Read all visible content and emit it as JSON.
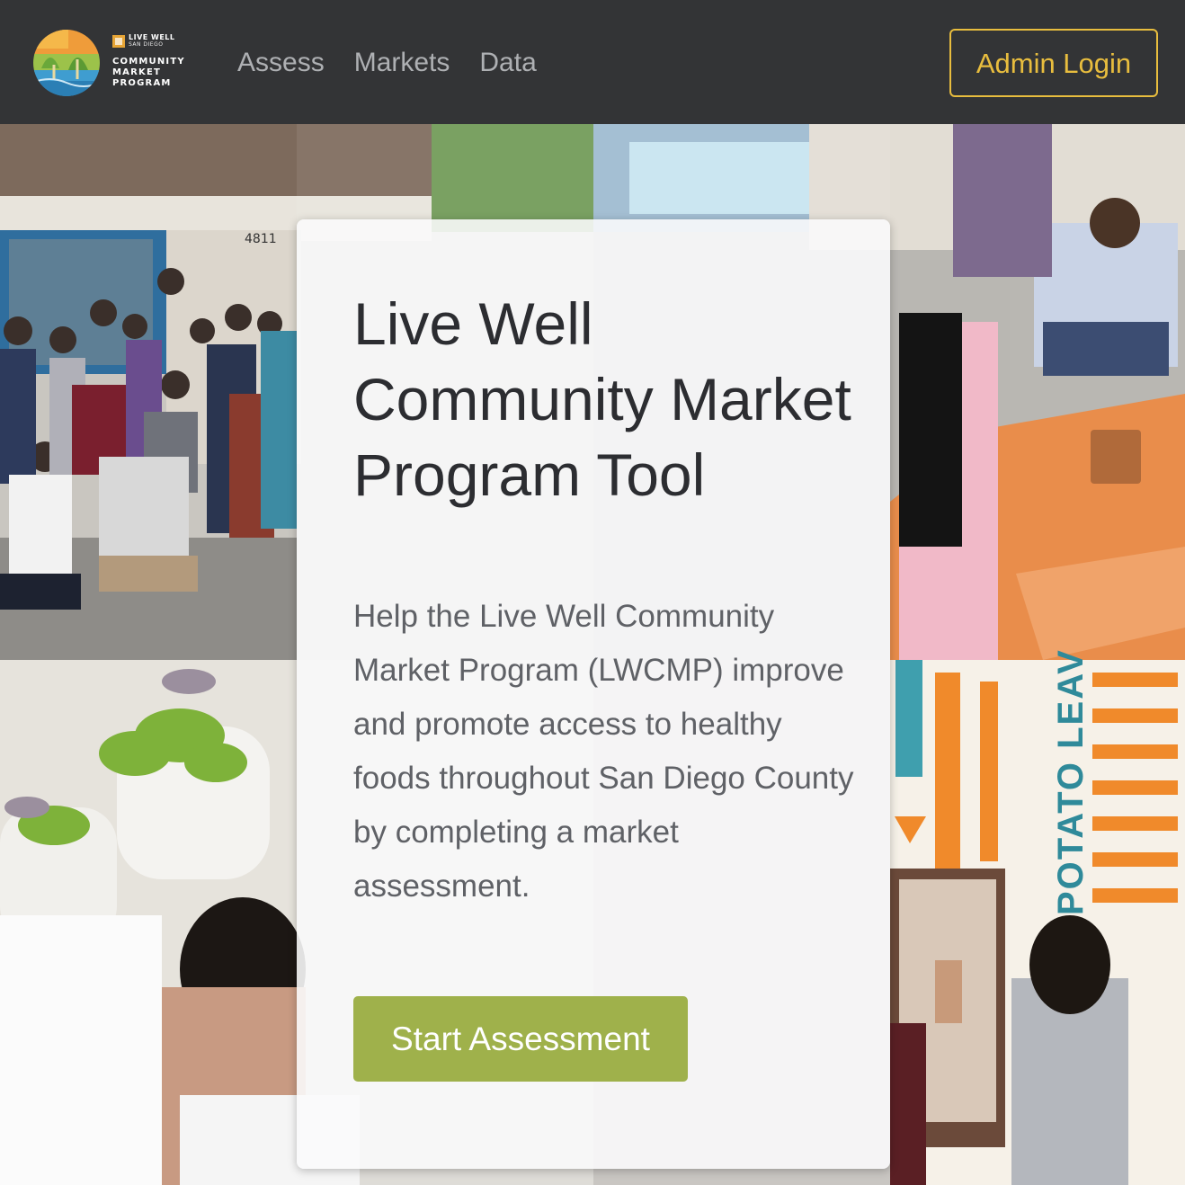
{
  "brand": {
    "line1": "LIVE WELL",
    "line2": "SAN DIEGO",
    "line3": "COMMUNITY",
    "line4": "MARKET",
    "line5": "PROGRAM"
  },
  "nav": {
    "links": [
      "Assess",
      "Markets",
      "Data"
    ],
    "admin_label": "Admin Login"
  },
  "hero": {
    "title": "Live Well Community Market Program Tool",
    "description": "Help the Live Well Community Market Program (LWCMP) improve and promote access to healthy foods throughout San Diego County by completing a market assessment.",
    "cta_label": "Start Assessment",
    "photo_texts": {
      "address": "4811",
      "mural": "POTATO LEAV"
    }
  },
  "colors": {
    "navbar": "#333436",
    "nav_link": "#aeb0b3",
    "accent_yellow": "#e8bd3e",
    "cta_green": "#9fb14b"
  }
}
